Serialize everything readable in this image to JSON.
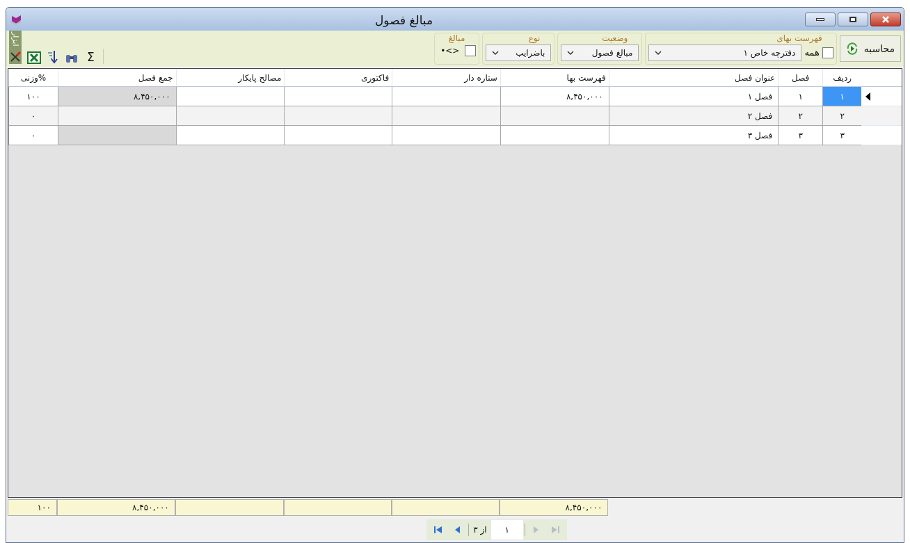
{
  "window": {
    "title": "مبالغ فصول"
  },
  "toolbar": {
    "calculate_button": "محاسبه",
    "price_list": {
      "legend": "فهرست بهای",
      "all_checkbox": {
        "label": "همه",
        "checked": false
      },
      "dropdown": {
        "value": "دفترچه خاص ۱"
      }
    },
    "status": {
      "legend": "وضعیت",
      "dropdown": {
        "value": "مبالغ فصول"
      }
    },
    "type": {
      "legend": "نوع",
      "dropdown": {
        "value": "باضرایب"
      }
    },
    "amounts": {
      "legend": "مبالغ",
      "checkbox": {
        "label": "•<>",
        "checked": false
      }
    },
    "sum_button": "Σ",
    "tools_tab": "ابزار"
  },
  "table": {
    "columns": [
      {
        "label": "ردیف",
        "readonly": false,
        "footer": false
      },
      {
        "label": "فصل",
        "readonly": false,
        "footer": false
      },
      {
        "label": "عنوان فصل",
        "readonly": false,
        "footer": false
      },
      {
        "label": "فهرست بها",
        "readonly": false,
        "footer": true,
        "total": "۸,۴۵۰,۰۰۰"
      },
      {
        "label": "ستاره دار",
        "readonly": false,
        "footer": true
      },
      {
        "label": "فاکتوری",
        "readonly": false,
        "footer": true
      },
      {
        "label": "مصالح پایکار",
        "readonly": false,
        "footer": true
      },
      {
        "label": "جمع فصل",
        "readonly": true,
        "footer": true,
        "total": "۸,۴۵۰,۰۰۰"
      },
      {
        "label": "%وزنی",
        "readonly": false,
        "footer": true,
        "total": "۱۰۰"
      }
    ],
    "rows": [
      {
        "current": true,
        "cells": [
          {
            "text": "۱",
            "selected": true
          },
          {
            "text": "۱",
            "selected": false
          },
          {
            "text": "فصل ۱",
            "selected": false
          },
          {
            "text": "۸,۴۵۰,۰۰۰",
            "selected": false
          },
          {
            "selected": false
          },
          {
            "selected": false
          },
          {
            "selected": false
          },
          {
            "text": "۸,۴۵۰,۰۰۰",
            "selected": false
          },
          {
            "text": "۱۰۰",
            "selected": false
          }
        ]
      },
      {
        "current": false,
        "cells": [
          {
            "text": "۲",
            "selected": false
          },
          {
            "text": "۲",
            "selected": false
          },
          {
            "text": "فصل ۲",
            "selected": false
          },
          {
            "selected": false
          },
          {
            "selected": false
          },
          {
            "selected": false
          },
          {
            "selected": false
          },
          {
            "selected": false
          },
          {
            "text": "۰",
            "selected": false
          }
        ]
      },
      {
        "current": false,
        "cells": [
          {
            "text": "۳",
            "selected": false
          },
          {
            "text": "۳",
            "selected": false
          },
          {
            "text": "فصل ۳",
            "selected": false
          },
          {
            "selected": false
          },
          {
            "selected": false
          },
          {
            "selected": false
          },
          {
            "selected": false
          },
          {
            "selected": false
          },
          {
            "text": "۰",
            "selected": false
          }
        ]
      }
    ]
  },
  "pager": {
    "page": "۱",
    "of_label": "از ۳",
    "first_disabled": false,
    "prev_disabled": false,
    "next_disabled": true,
    "last_disabled": true
  }
}
